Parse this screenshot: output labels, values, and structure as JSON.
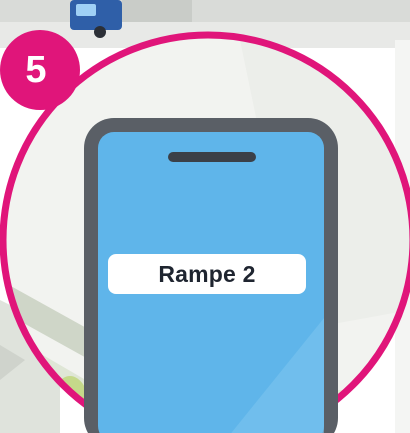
{
  "step": {
    "number": "5"
  },
  "phone": {
    "screen_label": "Rampe 2"
  },
  "colors": {
    "accent_magenta": "#e0157a",
    "phone_frame": "#5a5f66",
    "phone_screen": "#5fb5ea",
    "label_background": "#ffffff",
    "scene_background": "#f2f3f0"
  },
  "icons": [
    "truck-icon",
    "smartphone-icon"
  ]
}
